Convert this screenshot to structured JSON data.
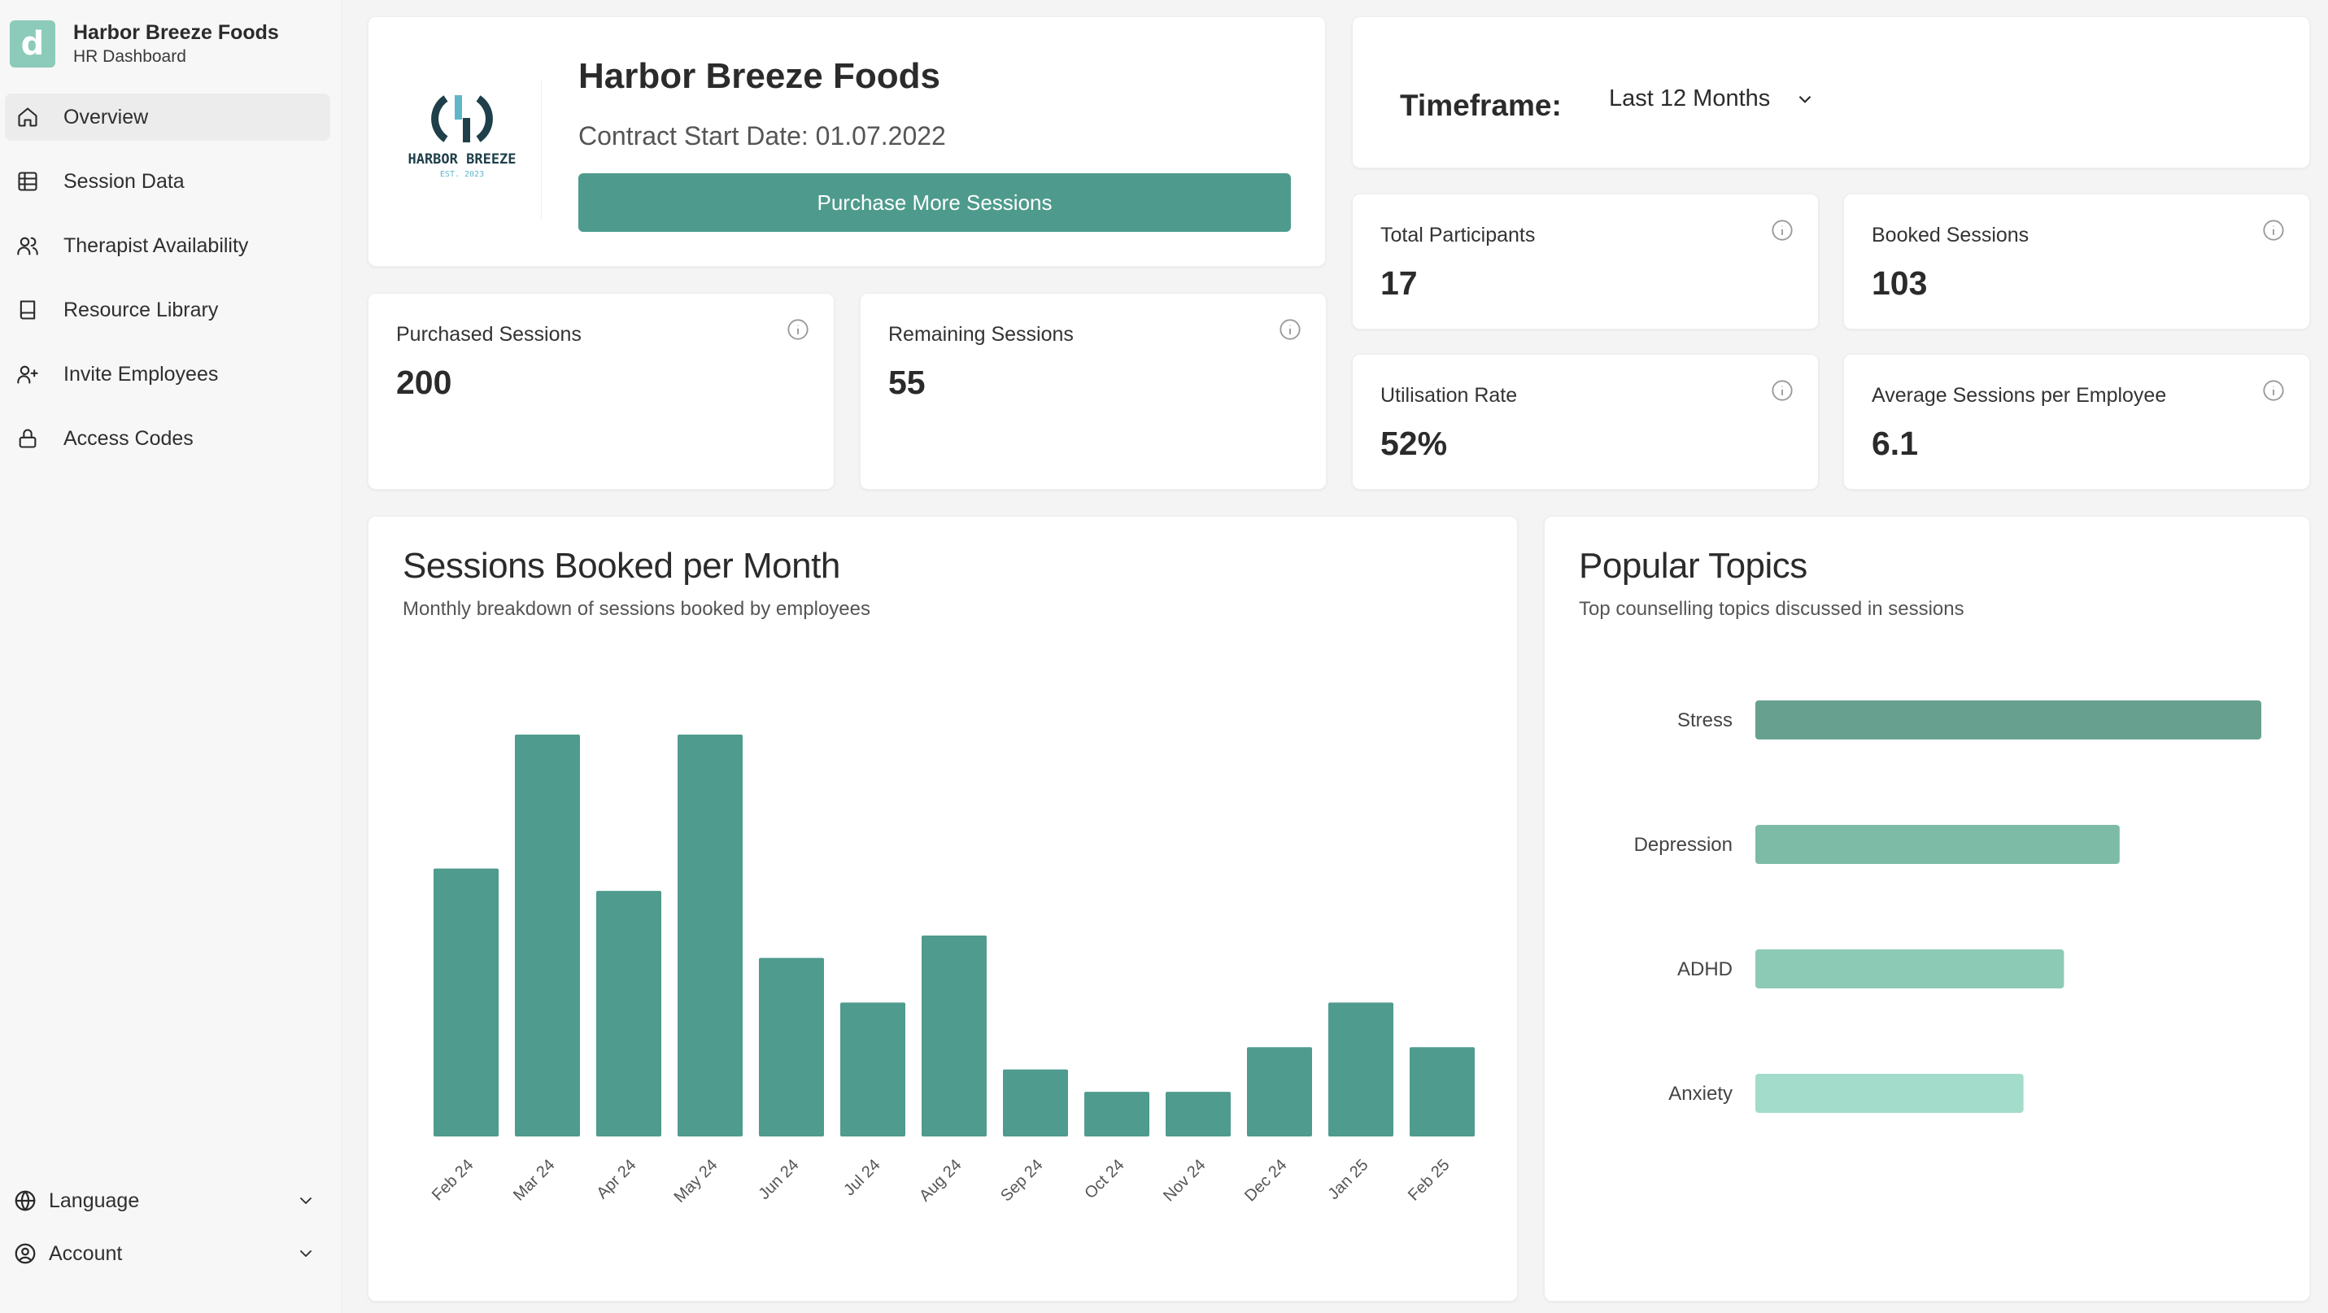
{
  "brand": {
    "name": "Harbor Breeze Foods",
    "subtitle": "HR Dashboard",
    "logo_letter": "d",
    "accent": "#8ccbb9"
  },
  "nav": [
    {
      "label": "Overview",
      "icon": "home-icon",
      "active": true
    },
    {
      "label": "Session Data",
      "icon": "table-icon"
    },
    {
      "label": "Therapist Availability",
      "icon": "users-icon"
    },
    {
      "label": "Resource Library",
      "icon": "book-icon"
    },
    {
      "label": "Invite Employees",
      "icon": "user-plus-icon"
    },
    {
      "label": "Access Codes",
      "icon": "lock-icon"
    }
  ],
  "bottom_nav": [
    {
      "label": "Language",
      "icon": "globe-icon"
    },
    {
      "label": "Account",
      "icon": "user-circle-icon"
    }
  ],
  "company": {
    "name": "Harbor Breeze Foods",
    "contract": "Contract Start Date: 01.07.2022",
    "purchase_label": "Purchase More Sessions",
    "logo_text": "HARBOR BREEZE",
    "logo_est": "EST. 2023"
  },
  "timeframe": {
    "label": "Timeframe:",
    "value": "Last 12 Months"
  },
  "stats": {
    "purchased": {
      "label": "Purchased Sessions",
      "value": "200"
    },
    "remaining": {
      "label": "Remaining Sessions",
      "value": "55"
    },
    "participants": {
      "label": "Total Participants",
      "value": "17"
    },
    "booked": {
      "label": "Booked Sessions",
      "value": "103"
    },
    "utilisation": {
      "label": "Utilisation Rate",
      "value": "52%"
    },
    "average": {
      "label": "Average Sessions per Employee",
      "value": "6.1"
    }
  },
  "colors": {
    "primary": "#4e9b8d",
    "bar": "#4f9b8e"
  },
  "chart_data": [
    {
      "type": "bar",
      "title": "Sessions Booked per Month",
      "subtitle": "Monthly breakdown of sessions booked by employees",
      "categories": [
        "Feb 24",
        "Mar 24",
        "Apr 24",
        "May 24",
        "Jun 24",
        "Jul 24",
        "Aug 24",
        "Sep 24",
        "Oct 24",
        "Nov 24",
        "Dec 24",
        "Jan 25",
        "Feb 25"
      ],
      "values": [
        12,
        18,
        11,
        18,
        8,
        6,
        9,
        3,
        2,
        2,
        4,
        6,
        4
      ],
      "ylim": [
        0,
        18
      ],
      "grid": false
    },
    {
      "type": "bar",
      "orientation": "horizontal",
      "title": "Popular Topics",
      "subtitle": "Top counselling topics discussed in sessions",
      "categories": [
        "Stress",
        "Depression",
        "ADHD",
        "Anxiety"
      ],
      "values": [
        100,
        72,
        61,
        53
      ],
      "colors": [
        "#67a08f",
        "#7dbba6",
        "#8dcab5",
        "#a3dcca"
      ],
      "grid": false
    }
  ]
}
